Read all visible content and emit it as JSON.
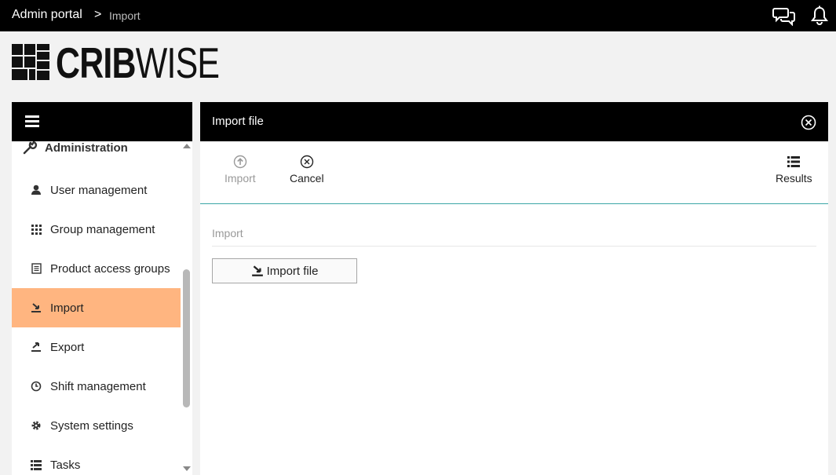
{
  "topbar": {
    "breadcrumb_root": "Admin portal",
    "breadcrumb_separator": ">",
    "breadcrumb_current": "Import",
    "icons": [
      "chat-icon",
      "bell-icon"
    ]
  },
  "logo": {
    "text_bold": "CRIB",
    "text_light": "WISE"
  },
  "sidebar": {
    "section_title": "Administration",
    "section_icon": "wrench-icon",
    "items": [
      {
        "label": "User management",
        "icon": "user-icon"
      },
      {
        "label": "Group management",
        "icon": "grid-icon"
      },
      {
        "label": "Product access groups",
        "icon": "list-doc-icon"
      },
      {
        "label": "Import",
        "icon": "import-icon",
        "active": true
      },
      {
        "label": "Export",
        "icon": "export-icon"
      },
      {
        "label": "Shift management",
        "icon": "clock-icon"
      },
      {
        "label": "System settings",
        "icon": "gear-icon"
      },
      {
        "label": "Tasks",
        "icon": "tasks-icon"
      }
    ]
  },
  "panel": {
    "title": "Import file",
    "toolbar": {
      "import_label": "Import",
      "cancel_label": "Cancel",
      "results_label": "Results"
    },
    "section_label": "Import",
    "import_file_button": "Import file"
  },
  "colors": {
    "active_item": "#ffb580",
    "toolbar_divider": "#3aa6a6",
    "header_bg": "#000000"
  }
}
